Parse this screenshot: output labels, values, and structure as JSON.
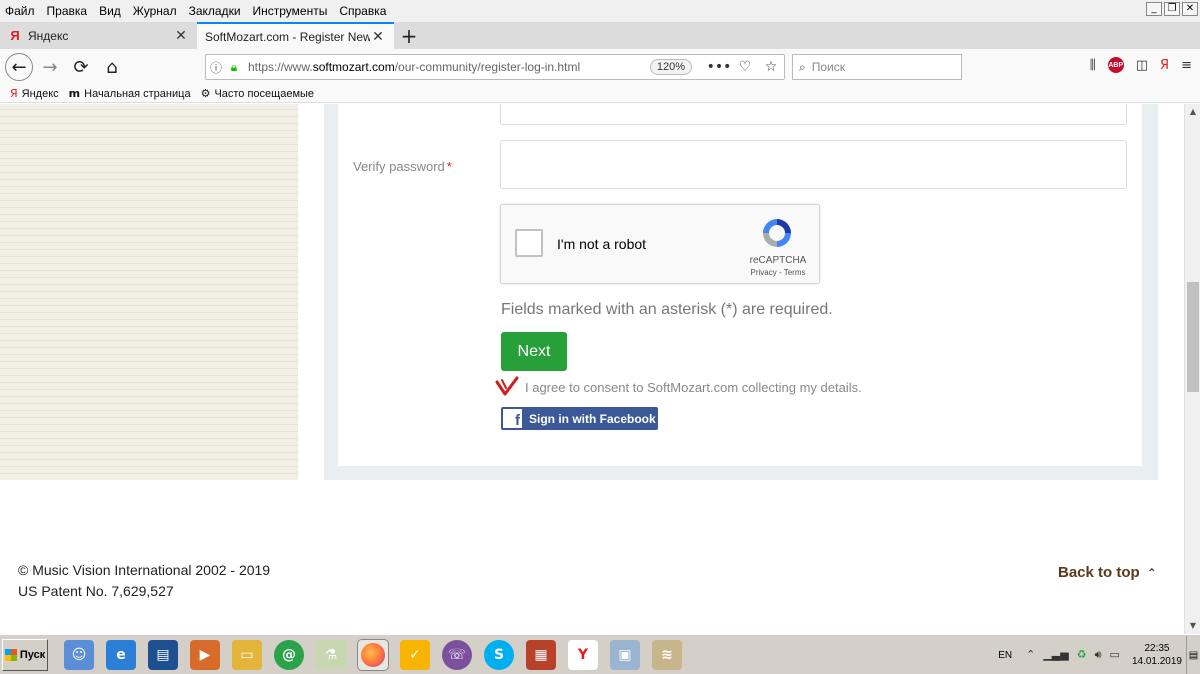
{
  "menubar": {
    "items": [
      "Файл",
      "Правка",
      "Вид",
      "Журнал",
      "Закладки",
      "Инструменты",
      "Справка"
    ],
    "window_controls": [
      "_",
      "❐",
      "✕"
    ]
  },
  "tabs": {
    "items": [
      {
        "label": "Яндекс",
        "favicon": "Я",
        "close": "✕"
      },
      {
        "label": "SoftMozart.com - Register New Use",
        "favicon": "",
        "close": "✕"
      }
    ],
    "new_tab": "+"
  },
  "navbar": {
    "back": "←",
    "forward": "→",
    "reload": "⟳",
    "home": "⌂",
    "url_prefix": "https://www.",
    "url_domain": "softmozart.com",
    "url_path": "/our-community/register-log-in.html",
    "zoom": "120%",
    "more": "•••",
    "pocket": "♡",
    "star": "☆",
    "search_placeholder": "Поиск",
    "abp": "ABP",
    "yandex": "Я",
    "menu": "≡"
  },
  "bookmarks": {
    "items": [
      {
        "icon": "Я",
        "label": "Яндекс"
      },
      {
        "icon": "m",
        "label": "Начальная страница"
      },
      {
        "icon": "⚙",
        "label": "Часто посещаемые"
      }
    ]
  },
  "form": {
    "verify_label": "Verify password",
    "required_mark": "*",
    "captcha_text": "I'm not a robot",
    "captcha_brand": "reCAPTCHA",
    "captcha_terms": "Privacy - Terms",
    "required_note": "Fields marked with an asterisk (*) are required.",
    "next_label": "Next",
    "agree_text": "I agree to consent to SoftMozart.com collecting my details.",
    "facebook_label": "Sign in with Facebook",
    "facebook_icon": "f"
  },
  "footer": {
    "copyright": "© Music Vision International 2002 - 2019",
    "patent": "US Patent No. 7,629,527",
    "back_to_top": "Back to top",
    "back_to_top_icon": "⌃"
  },
  "taskbar": {
    "start_label": "Пуск",
    "language": "EN",
    "time": "22:35",
    "date": "14.01.2019"
  }
}
